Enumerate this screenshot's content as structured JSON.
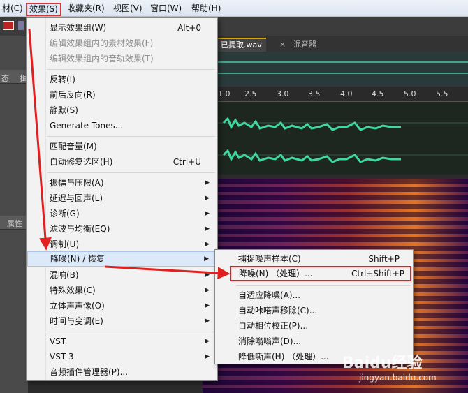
{
  "menubar": {
    "items": [
      "材(C)",
      "效果(S)",
      "收藏夹(R)",
      "视图(V)",
      "窗口(W)",
      "帮助(H)"
    ]
  },
  "left_panel": {
    "label1": "态",
    "label2": "揖",
    "props_tab": "属性"
  },
  "editor": {
    "tabs": [
      "已提取.wav",
      "×",
      "混音器"
    ],
    "ruler_ticks": [
      "1.0",
      "2.5",
      "3.0",
      "3.5",
      "4.0",
      "4.5",
      "5.0",
      "5.5"
    ]
  },
  "effects_menu": {
    "items": [
      {
        "label": "显示效果组(W)",
        "shortcut": "Alt+0"
      },
      {
        "label": "编辑效果组内的素材效果(F)",
        "disabled": true
      },
      {
        "label": "编辑效果组内的音轨效果(T)",
        "disabled": true
      },
      {
        "label": "反转(I)"
      },
      {
        "label": "前后反向(R)"
      },
      {
        "label": "静默(S)"
      },
      {
        "label": "Generate Tones..."
      },
      {
        "label": "匹配音量(M)"
      },
      {
        "label": "自动修复选区(H)",
        "shortcut": "Ctrl+U"
      },
      {
        "label": "振幅与压限(A)",
        "submenu": true
      },
      {
        "label": "延迟与回声(L)",
        "submenu": true
      },
      {
        "label": "诊断(G)",
        "submenu": true
      },
      {
        "label": "滤波与均衡(EQ)",
        "submenu": true
      },
      {
        "label": "调制(U)",
        "submenu": true
      },
      {
        "label": "降噪(N) / 恢复",
        "submenu": true,
        "highlighted": true
      },
      {
        "label": "混响(B)",
        "submenu": true
      },
      {
        "label": "特殊效果(C)",
        "submenu": true
      },
      {
        "label": "立体声声像(O)",
        "submenu": true
      },
      {
        "label": "时间与变调(E)",
        "submenu": true
      },
      {
        "label": "VST",
        "submenu": true
      },
      {
        "label": "VST 3",
        "submenu": true
      },
      {
        "label": "音频插件管理器(P)..."
      }
    ]
  },
  "noise_submenu": {
    "items": [
      {
        "label": "捕捉噪声样本(C)",
        "shortcut": "Shift+P"
      },
      {
        "label": "降噪(N) （处理）...",
        "shortcut": "Ctrl+Shift+P",
        "boxed": true
      },
      {
        "label": "自适应降噪(A)..."
      },
      {
        "label": "自动咔嗒声移除(C)..."
      },
      {
        "label": "自动相位校正(P)..."
      },
      {
        "label": "消除嗡嗡声(D)..."
      },
      {
        "label": "降低嘶声(H) （处理）..."
      }
    ]
  },
  "watermark": {
    "logo": "Baidu经验",
    "url": "jingyan.baidu.com"
  },
  "colors": {
    "annotation_red": "#e02020",
    "wave_green": "#3fd8a0",
    "highlight": "#dce9f8"
  }
}
